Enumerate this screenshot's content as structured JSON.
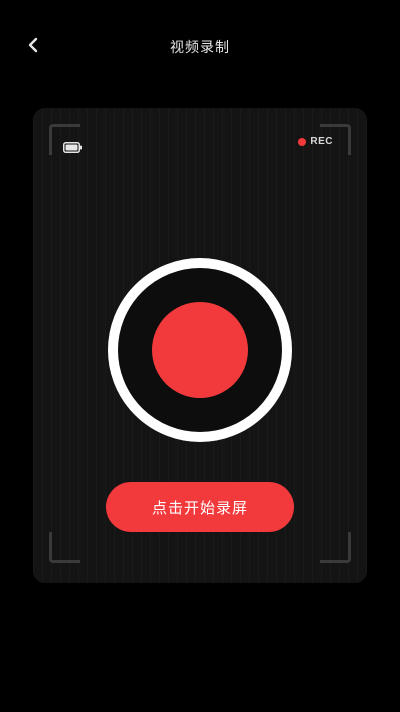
{
  "header": {
    "back_icon": "chevron-left-icon",
    "title": "视频录制"
  },
  "viewfinder": {
    "battery_icon": "battery-icon",
    "rec_indicator": {
      "label": "REC",
      "color": "#f23a3c"
    },
    "record_button_icon": "record-icon"
  },
  "actions": {
    "start_label": "点击开始录屏"
  },
  "colors": {
    "background": "#000000",
    "panel": "#141414",
    "accent": "#f23a3c",
    "ring": "#ffffff"
  }
}
